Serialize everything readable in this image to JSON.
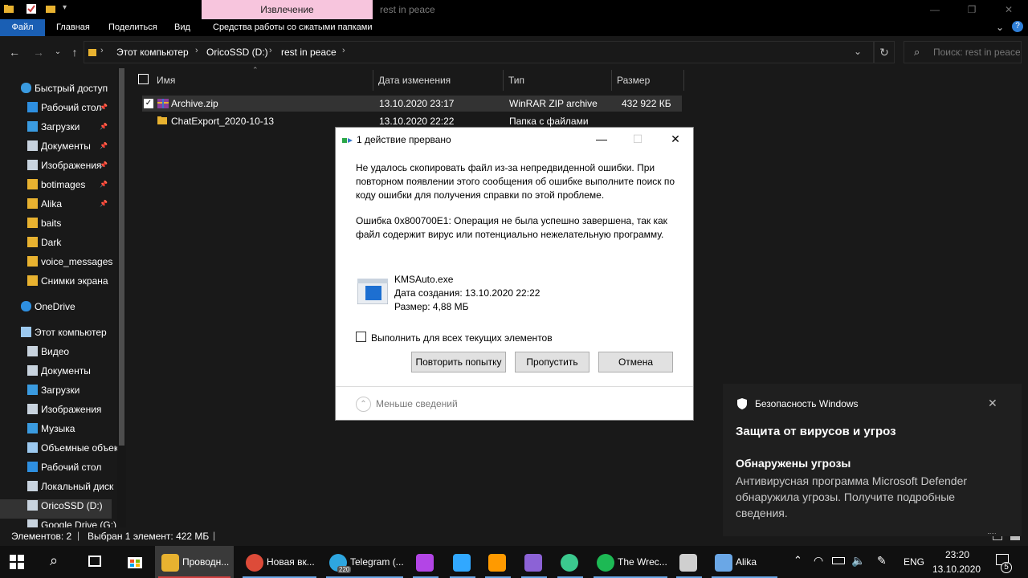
{
  "titlebar": {
    "context_tab": "Извлечение",
    "title": "rest in peace",
    "controls": [
      "—",
      "❐",
      "✕"
    ]
  },
  "ribbon": {
    "tabs": [
      "Файл",
      "Главная",
      "Поделиться",
      "Вид",
      "Средства работы со сжатыми папками"
    ]
  },
  "address": {
    "crumbs": [
      "Этот компьютер",
      "OricoSSD (D:)",
      "rest in peace"
    ],
    "search_placeholder": "Поиск: rest in peace"
  },
  "sidebar": {
    "items": [
      {
        "label": "Быстрый доступ",
        "icon": "star-icon"
      },
      {
        "label": "Рабочий стол",
        "icon": "desktop-icon"
      },
      {
        "label": "Загрузки",
        "icon": "download-icon"
      },
      {
        "label": "Документы",
        "icon": "documents-icon"
      },
      {
        "label": "Изображения",
        "icon": "pictures-icon"
      },
      {
        "label": "botimages",
        "icon": "folder-icon"
      },
      {
        "label": "Alika",
        "icon": "folder-icon"
      },
      {
        "label": "baits",
        "icon": "folder-icon"
      },
      {
        "label": "Dark",
        "icon": "folder-icon"
      },
      {
        "label": "voice_messages",
        "icon": "folder-icon"
      },
      {
        "label": "Снимки экрана",
        "icon": "folder-icon"
      },
      {
        "label": "OneDrive",
        "icon": "cloud-icon"
      },
      {
        "label": "Этот компьютер",
        "icon": "computer-icon"
      },
      {
        "label": "Видео",
        "icon": "video-icon"
      },
      {
        "label": "Документы",
        "icon": "documents-icon"
      },
      {
        "label": "Загрузки",
        "icon": "download-icon"
      },
      {
        "label": "Изображения",
        "icon": "pictures-icon"
      },
      {
        "label": "Музыка",
        "icon": "music-icon"
      },
      {
        "label": "Объемные объекты",
        "icon": "3d-objects-icon"
      },
      {
        "label": "Рабочий стол",
        "icon": "desktop-icon"
      },
      {
        "label": "Локальный диск",
        "icon": "drive-icon"
      },
      {
        "label": "OricoSSD (D:)",
        "icon": "drive-icon"
      },
      {
        "label": "Google Drive (G:)",
        "icon": "drive-icon"
      }
    ]
  },
  "filelist": {
    "columns": [
      "Имя",
      "Дата изменения",
      "Тип",
      "Размер"
    ],
    "rows": [
      {
        "name": "Archive.zip",
        "date": "13.10.2020 23:17",
        "type": "WinRAR ZIP archive",
        "size": "432 922 КБ"
      },
      {
        "name": "ChatExport_2020-10-13",
        "date": "13.10.2020 22:22",
        "type": "Папка с файлами",
        "size": ""
      }
    ]
  },
  "statusbar": {
    "items_count": "Элементов: 2",
    "selected": "Выбран 1 элемент: 422 МБ"
  },
  "dialog": {
    "title": "1 действие прервано",
    "message1": "Не удалось скопировать файл из-за непредвиденной ошибки. При повторном появлении этого сообщения об ошибке выполните поиск по коду ошибки для получения справки по этой проблеме.",
    "message2": "Ошибка 0x800700E1: Операция не была успешно завершена, так как файл содержит вирус или потенциально нежелательную программу.",
    "file_name": "KMSAuto.exe",
    "file_created": "Дата создания: 13.10.2020 22:22",
    "file_size": "Размер: 4,88 МБ",
    "apply_all": "Выполнить для всех текущих элементов",
    "retry": "Повторить попытку",
    "skip": "Пропустить",
    "cancel": "Отмена",
    "less_details": "Меньше сведений"
  },
  "toast": {
    "app": "Безопасность Windows",
    "heading": "Защита от вирусов и угроз",
    "title": "Обнаружены угрозы",
    "body": "Антивирусная программа Microsoft Defender обнаружила угрозы. Получите подробные сведения."
  },
  "taskbar": {
    "apps": [
      {
        "label": "Проводн...",
        "color": "#e8b230"
      },
      {
        "label": "Новая вк...",
        "color": "#dd4b39"
      },
      {
        "label": "Telegram (...",
        "color": "#2ea6e0",
        "badge": "220"
      },
      {
        "label": "",
        "color": "#b345e6"
      },
      {
        "label": "",
        "color": "#31a8ff"
      },
      {
        "label": "",
        "color": "#ff9a00"
      },
      {
        "label": "",
        "color": "#8c62d6"
      },
      {
        "label": "",
        "color": "#3bc98e"
      },
      {
        "label": "The Wrec...",
        "color": "#1db954"
      },
      {
        "label": "",
        "color": "#cfcfcf"
      },
      {
        "label": "Alika",
        "color": "#6aa7e6"
      }
    ],
    "lang": "ENG",
    "time": "23:20",
    "date": "13.10.2020",
    "notifications": "5"
  }
}
